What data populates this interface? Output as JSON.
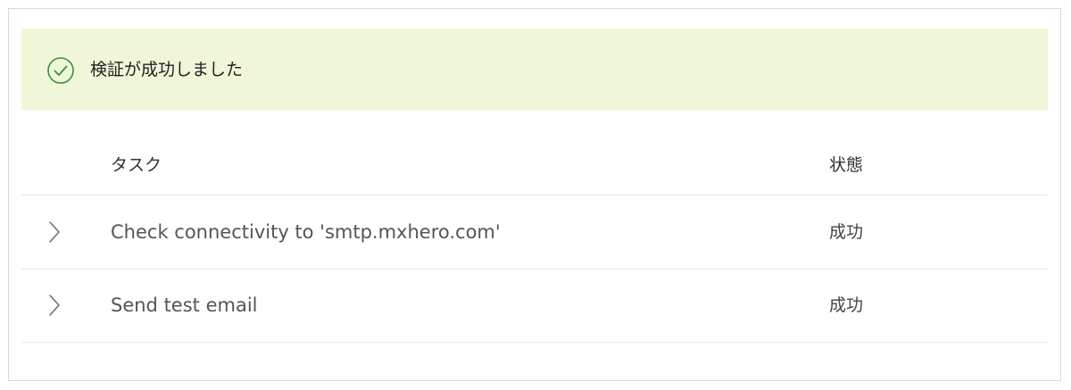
{
  "banner": {
    "message": "検証が成功しました",
    "icon": "check-circle-icon",
    "background_color": "#f0f7d8",
    "icon_color": "#3a8f3a"
  },
  "table": {
    "columns": {
      "task": "タスク",
      "status": "状態"
    },
    "rows": [
      {
        "task": "Check connectivity to 'smtp.mxhero.com'",
        "status": "成功",
        "icon": "chevron-right-icon"
      },
      {
        "task": "Send test email",
        "status": "成功",
        "icon": "chevron-right-icon"
      }
    ]
  }
}
